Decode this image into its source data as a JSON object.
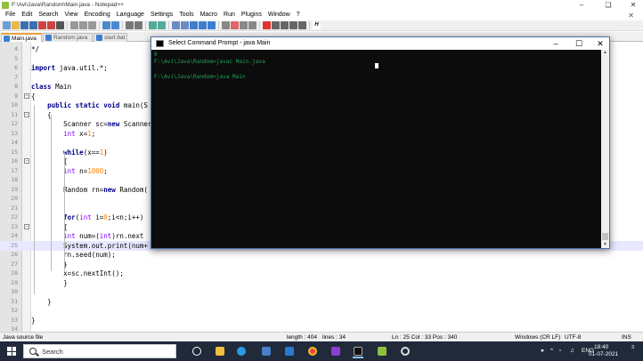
{
  "notepad": {
    "title": "F:\\Avi\\Java\\Random\\Main.java - Notepad++",
    "menu": [
      "File",
      "Edit",
      "Search",
      "View",
      "Encoding",
      "Language",
      "Settings",
      "Tools",
      "Macro",
      "Run",
      "Plugins",
      "Window",
      "?"
    ],
    "tabs": [
      {
        "label": "Main.java"
      },
      {
        "label": "Random.java"
      },
      {
        "label": "start.bat"
      }
    ],
    "editor": {
      "lines": [
        {
          "num": "4",
          "text": "*/",
          "cls": "cm"
        },
        {
          "num": "5",
          "text": ""
        },
        {
          "num": "6",
          "text": "import java.util.*;"
        },
        {
          "num": "7",
          "text": ""
        },
        {
          "num": "8",
          "text": "class Main"
        },
        {
          "num": "9",
          "text": "{",
          "fold": "−"
        },
        {
          "num": "10",
          "text": "    public static void main(S"
        },
        {
          "num": "11",
          "text": "    {",
          "fold": "−"
        },
        {
          "num": "12",
          "text": "        Scanner sc=new Scanner"
        },
        {
          "num": "13",
          "text": "        int x=1;"
        },
        {
          "num": "14",
          "text": ""
        },
        {
          "num": "15",
          "text": "        while(x==1)"
        },
        {
          "num": "16",
          "text": "        {",
          "fold": "−"
        },
        {
          "num": "17",
          "text": "        int n=1000;"
        },
        {
          "num": "18",
          "text": ""
        },
        {
          "num": "19",
          "text": "        Random rn=new Random("
        },
        {
          "num": "20",
          "text": ""
        },
        {
          "num": "21",
          "text": ""
        },
        {
          "num": "22",
          "text": "        for(int i=0;i<n;i++)"
        },
        {
          "num": "23",
          "text": "        {",
          "fold": "−"
        },
        {
          "num": "24",
          "text": "        int num=(int)rn.next"
        },
        {
          "num": "25",
          "text": "        System.out.print(num+",
          "current": true
        },
        {
          "num": "26",
          "text": "        rn.seed(num);"
        },
        {
          "num": "27",
          "text": "        }"
        },
        {
          "num": "28",
          "text": "        x=sc.nextInt();"
        },
        {
          "num": "29",
          "text": "        }"
        },
        {
          "num": "30",
          "text": ""
        },
        {
          "num": "31",
          "text": "    }"
        },
        {
          "num": "32",
          "text": ""
        },
        {
          "num": "33",
          "text": "}"
        },
        {
          "num": "34",
          "text": ""
        }
      ]
    },
    "status": {
      "file_type": "Java source file",
      "length": "length : 404",
      "lines": "lines : 34",
      "position": "Ln : 25   Col : 33   Pos : 340",
      "eol": "Windows (CR LF)",
      "encoding": "UTF-8",
      "mode": "INS"
    }
  },
  "cmd": {
    "title": "Select Command Prompt - java  Main",
    "lines": [
      "0",
      "F:\\Avi\\Java\\Random>javac Main.java",
      "",
      "F:\\Avi\\Java\\Random>java Main"
    ]
  },
  "taskbar": {
    "search_placeholder": "Search",
    "tray": {
      "lang": "ENG",
      "time": "18:40",
      "date": "01-07-2021",
      "notif_count": "3"
    }
  }
}
